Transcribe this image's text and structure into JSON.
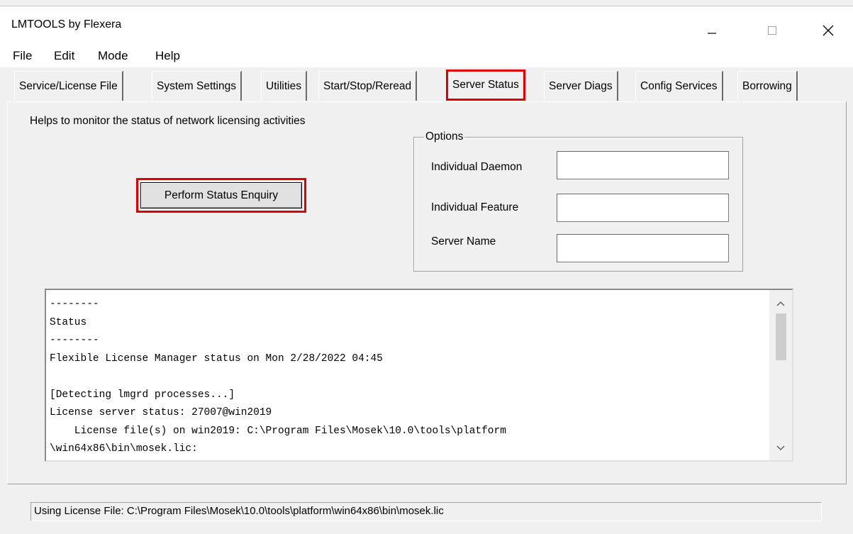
{
  "window": {
    "title": "LMTOOLS by Flexera"
  },
  "menu": [
    "File",
    "Edit",
    "Mode",
    "Help"
  ],
  "tabs": [
    {
      "label": "Service/License File"
    },
    {
      "label": "System Settings"
    },
    {
      "label": "Utilities"
    },
    {
      "label": "Start/Stop/Reread"
    },
    {
      "label": "Server Status"
    },
    {
      "label": "Server Diags"
    },
    {
      "label": "Config Services"
    },
    {
      "label": "Borrowing"
    }
  ],
  "server_status": {
    "description": "Helps to monitor the status of network licensing activities",
    "enquiry_button": "Perform Status Enquiry",
    "options": {
      "legend": "Options",
      "daemon_label": "Individual Daemon",
      "daemon_value": "",
      "feature_label": "Individual Feature",
      "feature_value": "",
      "server_label": "Server Name",
      "server_value": ""
    },
    "console_text": "--------\nStatus\n--------\nFlexible License Manager status on Mon 2/28/2022 04:45\n\n[Detecting lmgrd processes...]\nLicense server status: 27007@win2019\n    License file(s) on win2019: C:\\Program Files\\Mosek\\10.0\\tools\\platform\n\\win64x86\\bin\\mosek.lic:"
  },
  "status_bar": "Using License File:  C:\\Program Files\\Mosek\\10.0\\tools\\platform\\win64x86\\bin\\mosek.lic",
  "icons": [
    "minimize-icon",
    "maximize-icon",
    "close-icon",
    "scroll-up-icon",
    "scroll-down-icon"
  ],
  "colors": {
    "highlight": "#e00000",
    "background": "#f0f0f0"
  }
}
